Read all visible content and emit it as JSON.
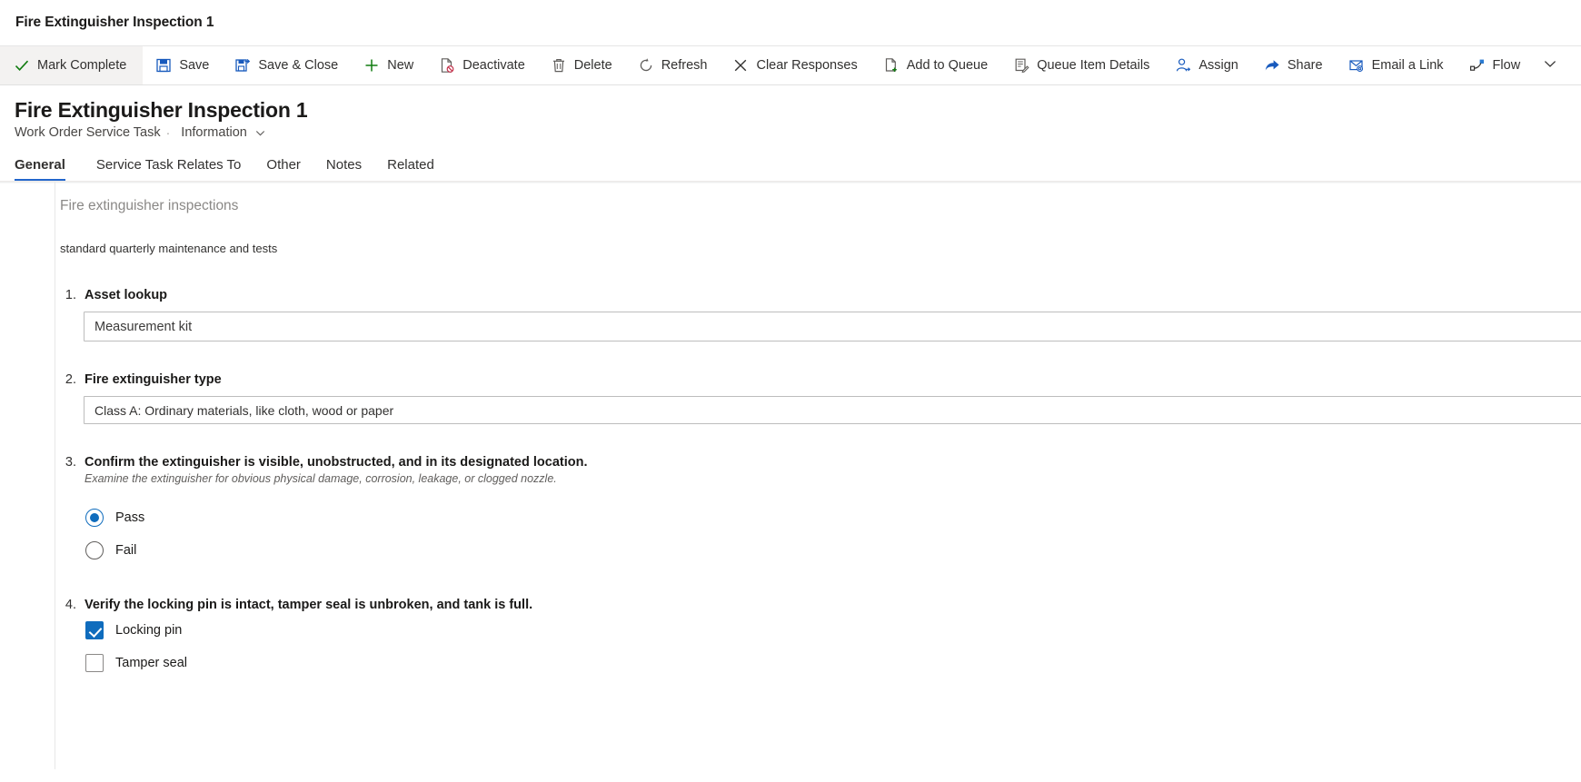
{
  "window": {
    "app_title": "Fire Extinguisher Inspection 1"
  },
  "commandbar": {
    "items": [
      {
        "label": "Mark Complete",
        "icon": "checkmark-icon"
      },
      {
        "label": "Save",
        "icon": "save-icon"
      },
      {
        "label": "Save & Close",
        "icon": "save-and-close-icon"
      },
      {
        "label": "New",
        "icon": "plus-icon"
      },
      {
        "label": "Deactivate",
        "icon": "deactivate-icon"
      },
      {
        "label": "Delete",
        "icon": "trash-icon"
      },
      {
        "label": "Refresh",
        "icon": "refresh-icon"
      },
      {
        "label": "Clear Responses",
        "icon": "close-x-icon"
      },
      {
        "label": "Add to Queue",
        "icon": "add-to-queue-icon"
      },
      {
        "label": "Queue Item Details",
        "icon": "queue-item-details-icon"
      },
      {
        "label": "Assign",
        "icon": "assign-person-icon"
      },
      {
        "label": "Share",
        "icon": "share-icon"
      },
      {
        "label": "Email a Link",
        "icon": "email-link-icon"
      },
      {
        "label": "Flow",
        "icon": "flow-icon"
      }
    ],
    "overflow_label": "More commands"
  },
  "formheader": {
    "record_title": "Fire Extinguisher Inspection 1",
    "entity_name": "Work Order Service Task",
    "separator": "·",
    "form_name": "Information"
  },
  "tabs": [
    {
      "label": "General",
      "active": true
    },
    {
      "label": "Service Task Relates To",
      "active": false
    },
    {
      "label": "Other",
      "active": false
    },
    {
      "label": "Notes",
      "active": false
    },
    {
      "label": "Related",
      "active": false
    }
  ],
  "inspection": {
    "title": "Fire extinguisher inspections",
    "description": "standard quarterly maintenance and tests",
    "questions": [
      {
        "number": "1.",
        "label": "Asset lookup",
        "type": "lookup",
        "value": "Measurement kit"
      },
      {
        "number": "2.",
        "label": "Fire extinguisher type",
        "type": "text",
        "value": "Class A: Ordinary materials, like cloth, wood or paper"
      },
      {
        "number": "3.",
        "label": "Confirm the extinguisher is visible, unobstructed, and in its designated location.",
        "help": "Examine the extinguisher for obvious physical damage, corrosion, leakage, or clogged nozzle.",
        "type": "radio",
        "options": [
          {
            "label": "Pass",
            "checked": true
          },
          {
            "label": "Fail",
            "checked": false
          }
        ]
      },
      {
        "number": "4.",
        "label": "Verify the locking pin is intact, tamper seal is unbroken, and tank is full.",
        "type": "checkbox",
        "options": [
          {
            "label": "Locking pin",
            "checked": true
          },
          {
            "label": "Tamper seal",
            "checked": false
          }
        ]
      }
    ]
  },
  "colors": {
    "accent": "#0f6cbd",
    "tab_underline": "#2266cc",
    "command_icon_blue": "#185abd",
    "command_icon_green": "#107c10",
    "text_primary": "#1b1a19",
    "text_secondary": "#605e5c",
    "muted": "#8a8886"
  }
}
